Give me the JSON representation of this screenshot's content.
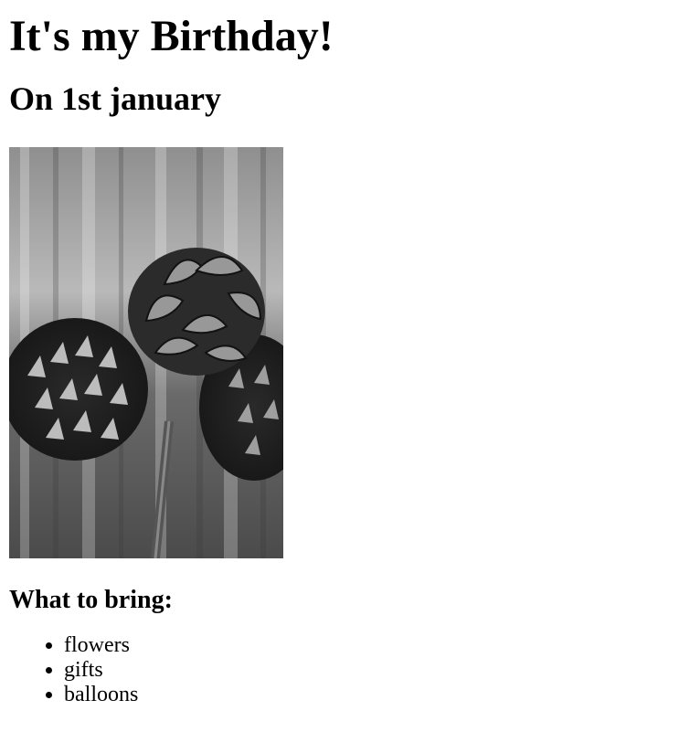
{
  "header": {
    "title": "It's my Birthday!",
    "subtitle": "On 1st january"
  },
  "photo": {
    "subject": "pine-cones-photo",
    "tone": "grayscale"
  },
  "bring": {
    "heading": "What to bring:",
    "items": [
      "flowers",
      "gifts",
      "balloons"
    ]
  }
}
